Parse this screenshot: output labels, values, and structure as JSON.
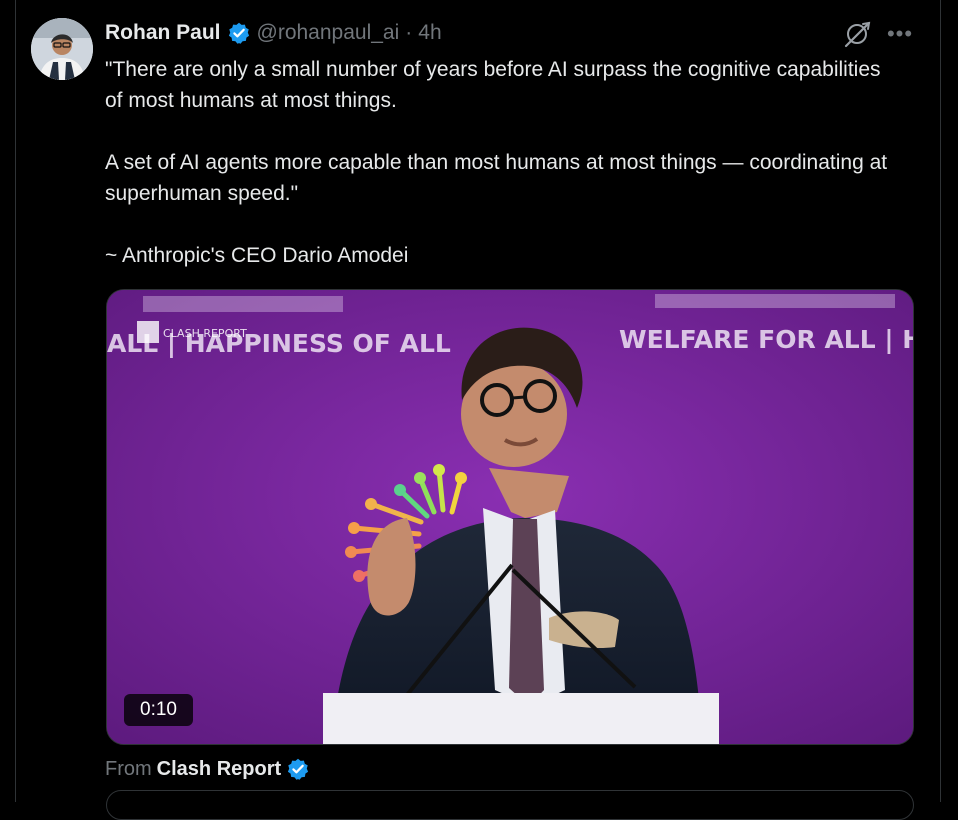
{
  "tweet": {
    "author_name": "Rohan Paul",
    "handle": "@rohanpaul_ai",
    "separator": "·",
    "time": "4h",
    "lines": [
      "\"There are only a small number of years before AI surpass the cognitive capabilities of most humans at most things.",
      "A set of AI agents more capable than most humans at most things — coordinating at superhuman speed.\"",
      "~ Anthropic's CEO Dario Amodei"
    ],
    "icons": {
      "verified": "verified-badge-icon",
      "grok": "grok-icon",
      "more": "more-icon"
    },
    "more_glyph": "•••"
  },
  "media": {
    "duration": "0:10",
    "banner_top_left": "ALL | HAPPINESS OF ALL",
    "banner_top_right": "WELFARE FOR ALL | HAP",
    "watermark": "CLASH REPORT"
  },
  "attribution": {
    "from_label": "From",
    "source_name": "Clash Report"
  },
  "colors": {
    "background": "#000000",
    "text": "#e7e9ea",
    "muted": "#71767b",
    "verified": "#1d9bf0",
    "stage_purple": "#6c238f"
  }
}
